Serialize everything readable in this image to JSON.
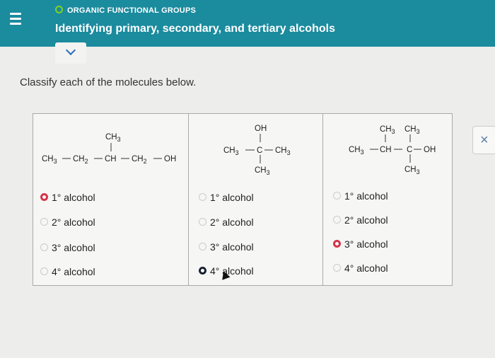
{
  "header": {
    "topic": "ORGANIC FUNCTIONAL GROUPS",
    "title": "Identifying primary, secondary, and tertiary alcohols",
    "accent": "#1b8b9e"
  },
  "prompt": "Classify each of the molecules below.",
  "molecules": [
    {
      "labels": [
        "CH3",
        "CH3",
        "CH2",
        "CH",
        "CH2",
        "OH"
      ],
      "options": [
        "1° alcohol",
        "2° alcohol",
        "3° alcohol",
        "4° alcohol"
      ],
      "selected": "1° alcohol"
    },
    {
      "labels": [
        "OH",
        "CH3",
        "C",
        "CH3",
        "CH3"
      ],
      "options": [
        "1° alcohol",
        "2° alcohol",
        "3° alcohol",
        "4° alcohol"
      ],
      "selected": "4° alcohol"
    },
    {
      "labels": [
        "CH3",
        "CH3",
        "CH3",
        "CH",
        "C",
        "OH",
        "CH3"
      ],
      "options": [
        "1° alcohol",
        "2° alcohol",
        "3° alcohol",
        "4° alcohol"
      ],
      "selected": "3° alcohol"
    }
  ],
  "close_glyph": "×",
  "icons": {
    "menu": "menu-icon",
    "status": "status-dot-icon",
    "chevron": "chevron-down-icon",
    "close": "close-icon"
  }
}
